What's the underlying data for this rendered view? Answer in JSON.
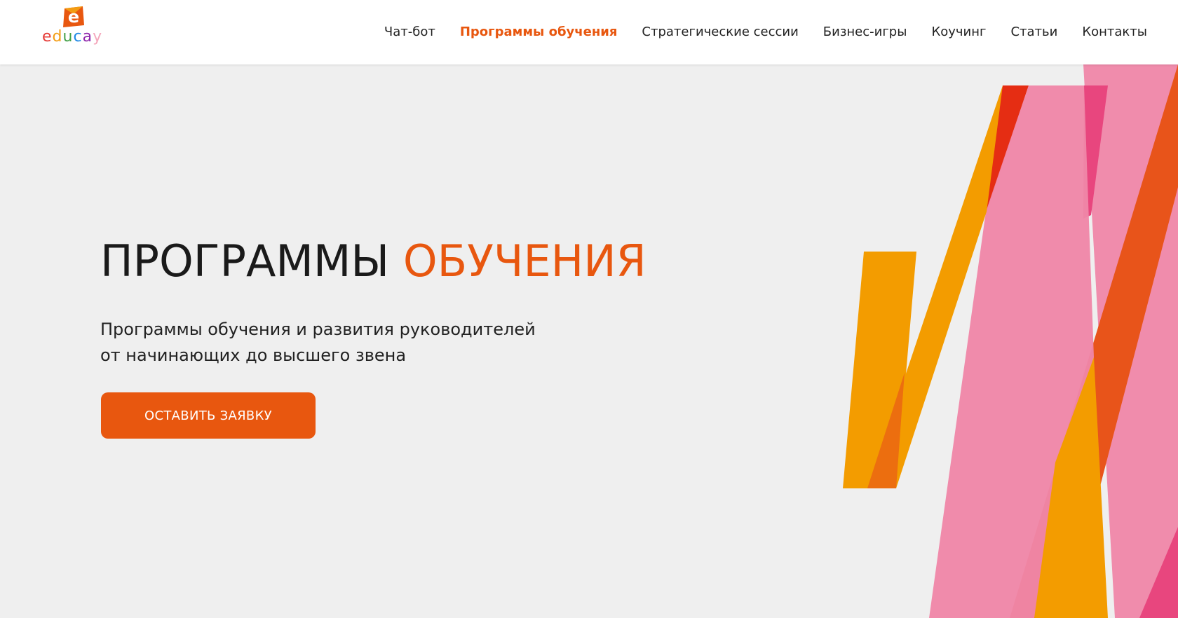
{
  "brand": {
    "logo_letter": "e",
    "name_letters": [
      "e",
      "d",
      "u",
      "c",
      "a",
      "y"
    ]
  },
  "nav": {
    "items": [
      {
        "label": "Чат-бот"
      },
      {
        "label": "Программы обучения",
        "active": true
      },
      {
        "label": "Стратегические сессии"
      },
      {
        "label": "Бизнес-игры"
      },
      {
        "label": "Коучинг"
      },
      {
        "label": "Статьи"
      },
      {
        "label": "Контакты"
      }
    ]
  },
  "hero": {
    "title_main": "ПРОГРАММЫ",
    "title_accent": "ОБУЧЕНИЯ",
    "subtitle_line1": "Программы обучения и развития руководителей",
    "subtitle_line2": "от начинающих до высшего звена",
    "cta_label": "ОСТАВИТЬ ЗАЯВКУ"
  },
  "colors": {
    "accent": "#e8570f",
    "orange_shape": "#f39c00",
    "pink_shape": "#ef86a8",
    "deep_orange_shape": "#e8541a",
    "red_shape": "#e52d13",
    "hero_bg": "#efefef"
  }
}
